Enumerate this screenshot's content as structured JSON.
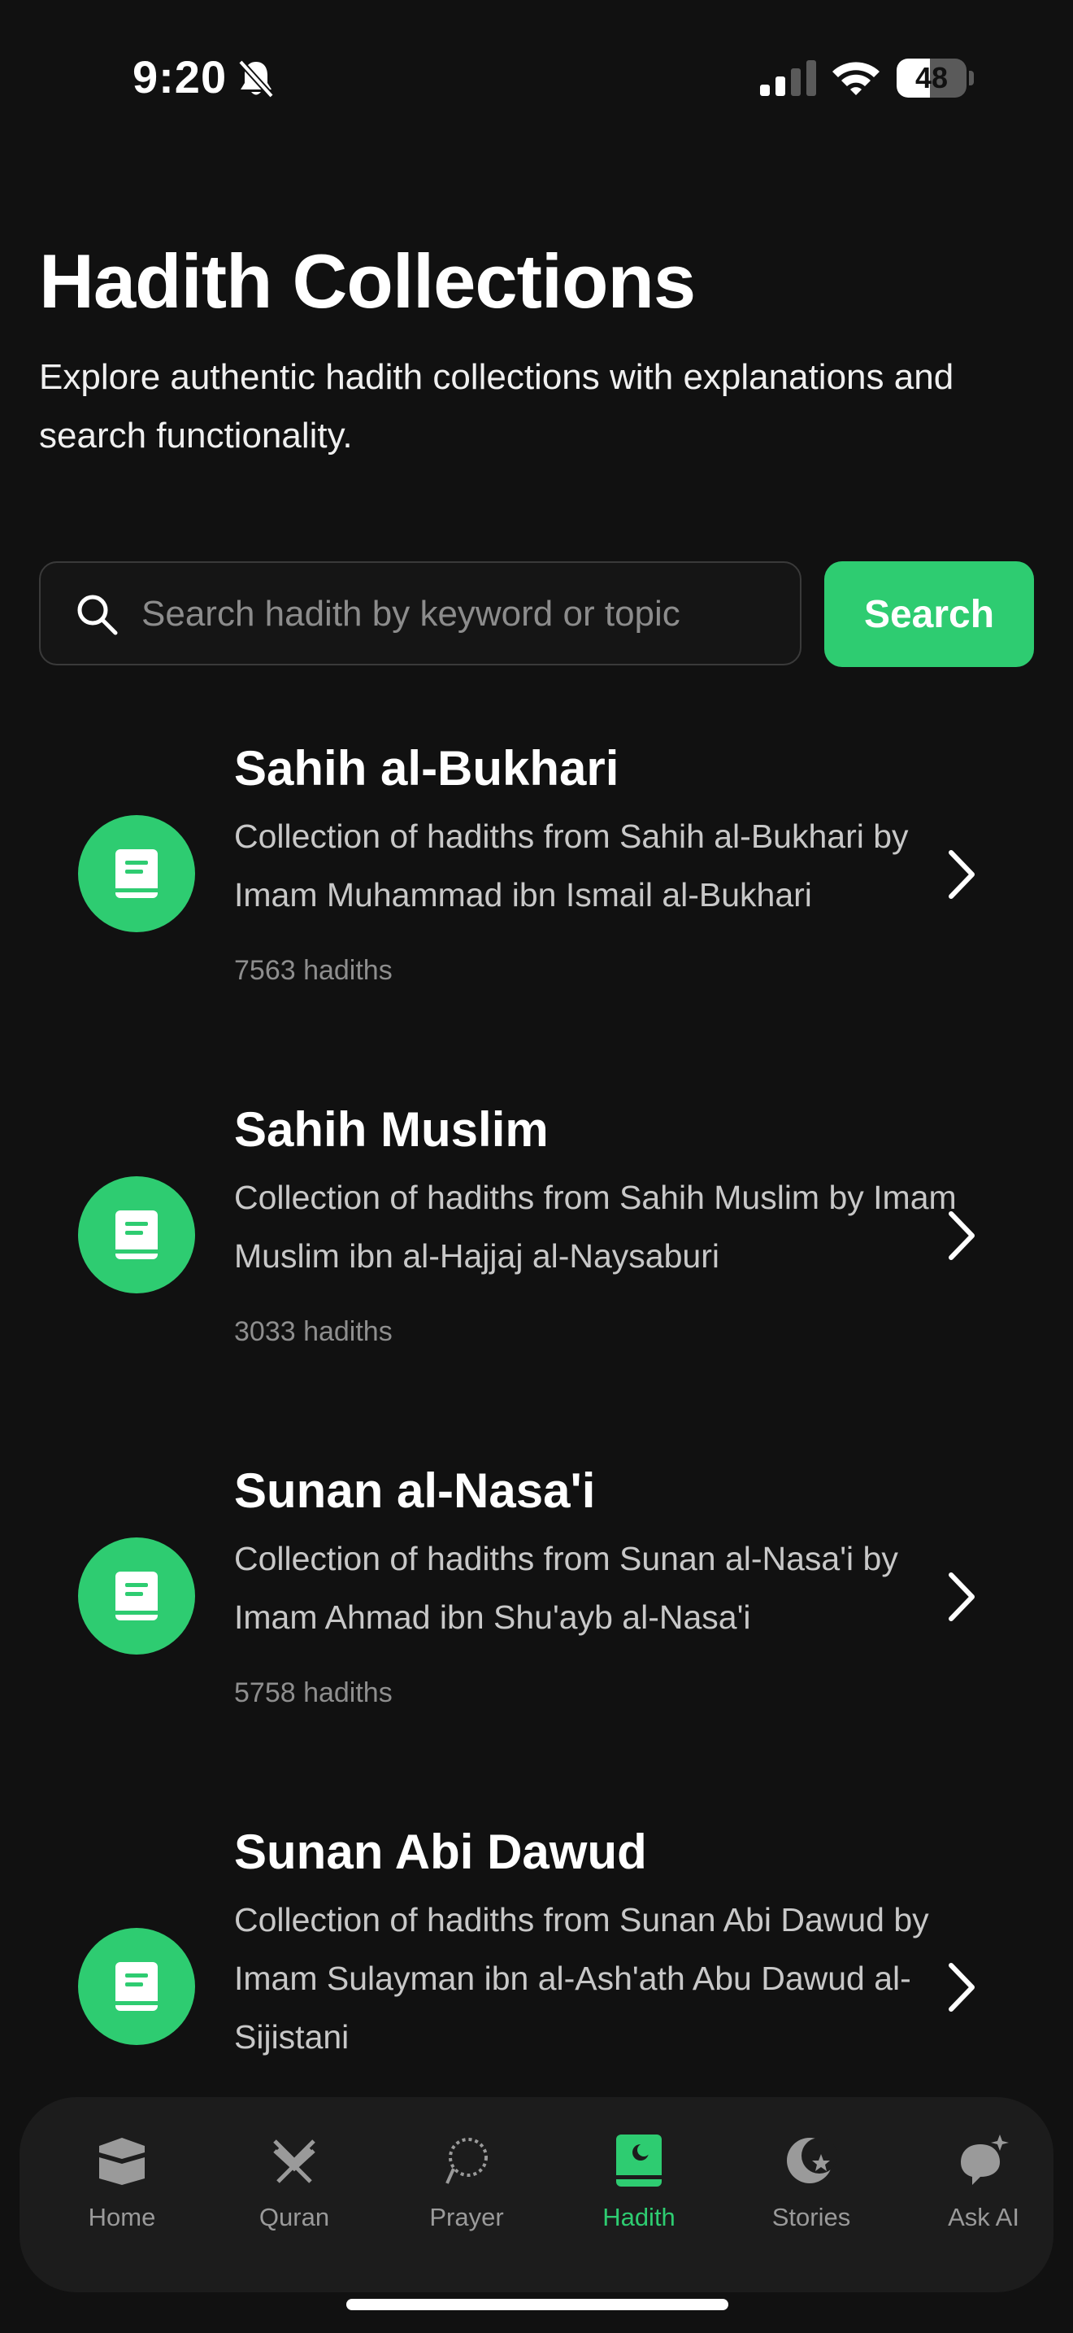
{
  "status_bar": {
    "time": "9:20",
    "battery": "48",
    "battery_level": 0.48
  },
  "header": {
    "title": "Hadith Collections",
    "subtitle": "Explore authentic hadith collections with explanations and search functionality."
  },
  "search": {
    "placeholder": "Search hadith by keyword or topic",
    "value": "",
    "button_label": "Search"
  },
  "collections": [
    {
      "title": "Sahih al-Bukhari",
      "description": "Collection of hadiths from Sahih al-Bukhari by Imam Muhammad ibn Ismail al-Bukhari",
      "count": "7563 hadiths"
    },
    {
      "title": "Sahih Muslim",
      "description": "Collection of hadiths from Sahih Muslim by Imam Muslim ibn al-Hajjaj al-Naysaburi",
      "count": "3033 hadiths"
    },
    {
      "title": "Sunan al-Nasa'i",
      "description": "Collection of hadiths from Sunan al-Nasa'i by Imam Ahmad ibn Shu'ayb al-Nasa'i",
      "count": "5758 hadiths"
    },
    {
      "title": "Sunan Abi Dawud",
      "description": "Collection of hadiths from Sunan Abi Dawud by Imam Sulayman ibn al-Ash'ath Abu Dawud al-Sijistani",
      "count": ""
    }
  ],
  "tabs": [
    {
      "label": "Home",
      "icon": "kaaba-icon",
      "active": false
    },
    {
      "label": "Quran",
      "icon": "quran-stand-icon",
      "active": false
    },
    {
      "label": "Prayer",
      "icon": "prayer-beads-icon",
      "active": false
    },
    {
      "label": "Hadith",
      "icon": "hadith-book-icon",
      "active": true
    },
    {
      "label": "Stories",
      "icon": "crescent-star-icon",
      "active": false
    },
    {
      "label": "Ask AI",
      "icon": "ai-chat-icon",
      "active": false
    }
  ],
  "colors": {
    "accent": "#2ecc71",
    "background": "#111111",
    "tab_bar": "#1c1c1c"
  }
}
